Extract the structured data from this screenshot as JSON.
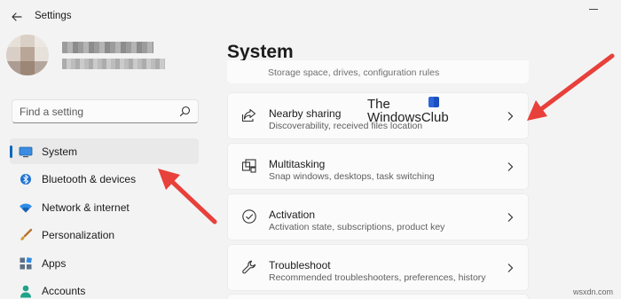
{
  "window": {
    "title": "Settings"
  },
  "search": {
    "placeholder": "Find a setting"
  },
  "sidebar": {
    "items": [
      {
        "label": "System",
        "icon": "monitor-icon",
        "active": true
      },
      {
        "label": "Bluetooth & devices",
        "icon": "bluetooth-icon",
        "active": false
      },
      {
        "label": "Network & internet",
        "icon": "wifi-icon",
        "active": false
      },
      {
        "label": "Personalization",
        "icon": "brush-icon",
        "active": false
      },
      {
        "label": "Apps",
        "icon": "apps-icon",
        "active": false
      },
      {
        "label": "Accounts",
        "icon": "person-icon",
        "active": false
      }
    ]
  },
  "main": {
    "title": "System",
    "partial_card_desc": "Storage space, drives, configuration rules",
    "cards": [
      {
        "title": "Nearby sharing",
        "desc": "Discoverability, received files location",
        "icon": "share-icon"
      },
      {
        "title": "Multitasking",
        "desc": "Snap windows, desktops, task switching",
        "icon": "multitasking-icon"
      },
      {
        "title": "Activation",
        "desc": "Activation state, subscriptions, product key",
        "icon": "checkmark-circle-icon"
      },
      {
        "title": "Troubleshoot",
        "desc": "Recommended troubleshooters, preferences, history",
        "icon": "wrench-icon"
      }
    ]
  },
  "watermark": {
    "line1": "The",
    "line2": "WindowsClub",
    "footer": "wsxdn.com"
  },
  "colors": {
    "accent": "#0067c0",
    "arrow": "#e8403a",
    "background": "#f3f3f3",
    "card": "#fbfbfb"
  }
}
